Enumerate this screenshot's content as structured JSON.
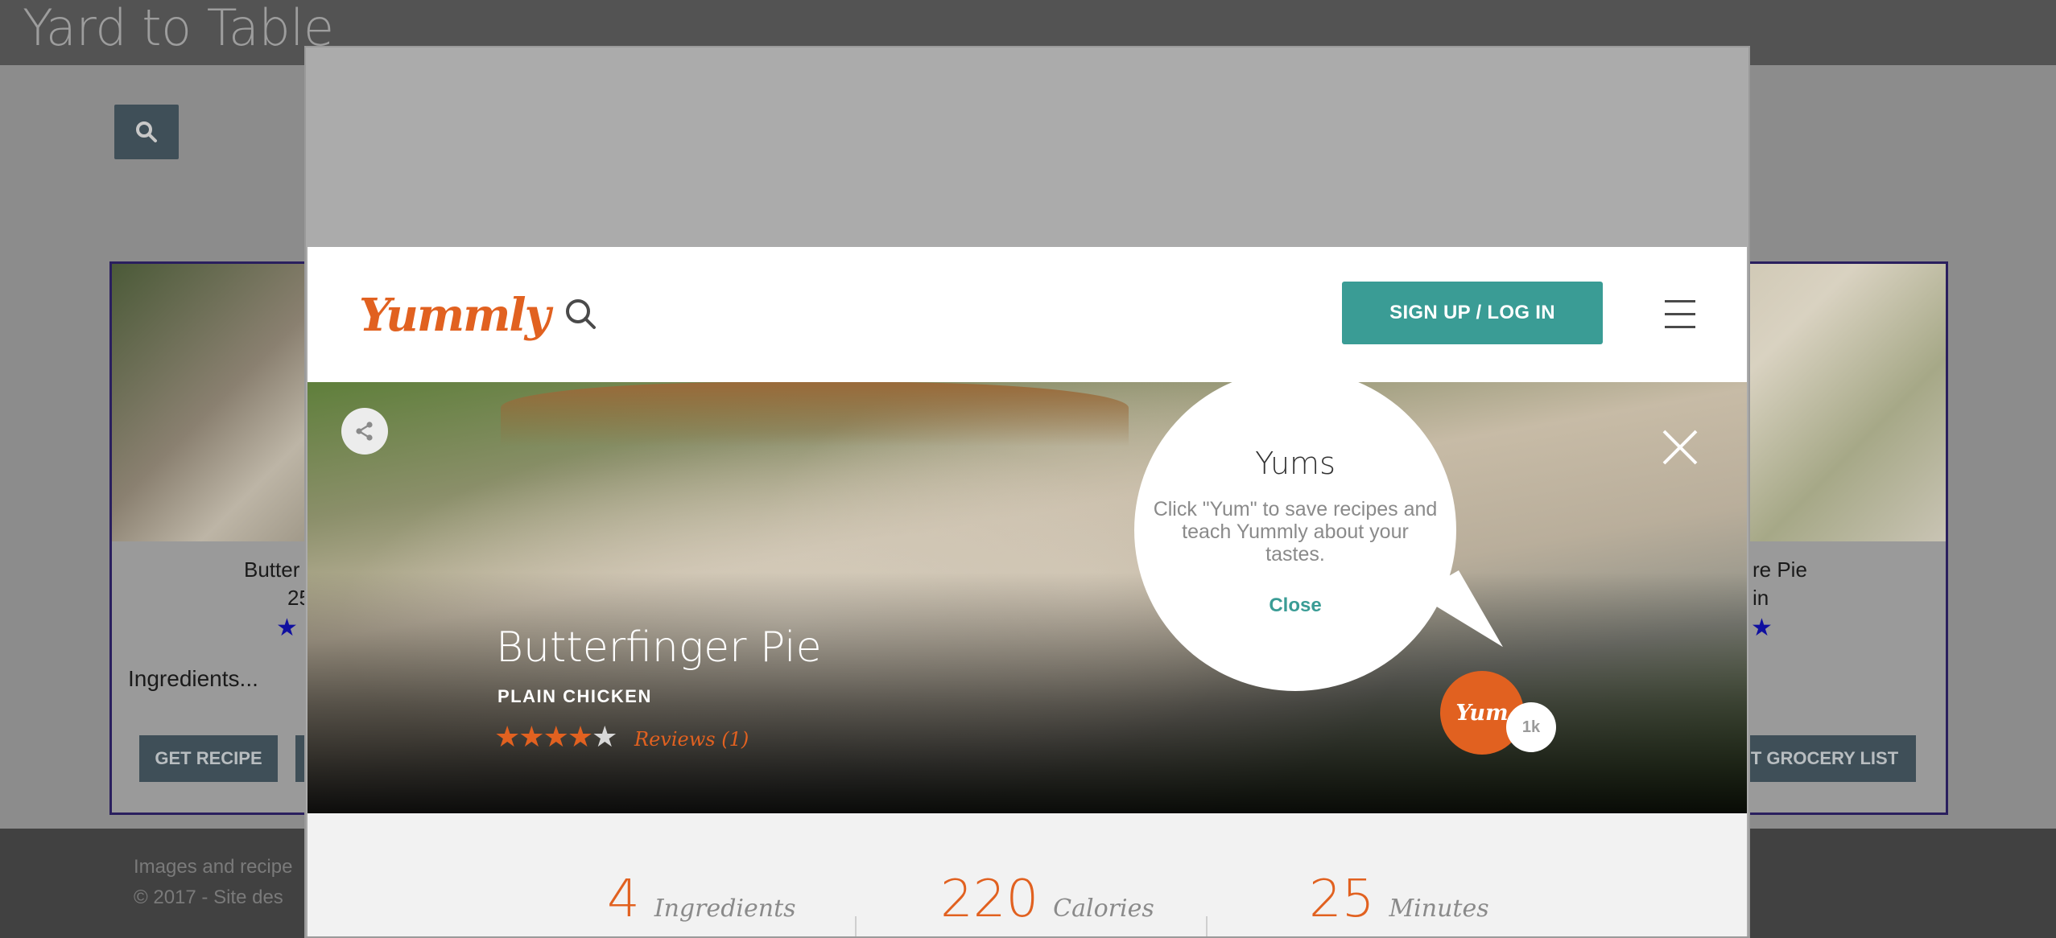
{
  "background": {
    "site_title": "Yard to Table",
    "left_card": {
      "name": "Butter",
      "time": "25",
      "stars": "★",
      "ingredients": "Ingredients...",
      "button": "GET RECIPE"
    },
    "right_card": {
      "name": "re Pie",
      "time": "in",
      "stars": "★",
      "button": "T GROCERY LIST"
    },
    "footer": {
      "line1": "Images and recipe",
      "line2": "© 2017 - Site des"
    }
  },
  "yummly": {
    "logo": "Yummly",
    "signup_label": "SIGN UP / LOG IN",
    "recipe": {
      "title": "Butterfinger Pie",
      "source": "PLAIN CHICKEN",
      "rating": 4,
      "max_rating": 5,
      "reviews_label": "Reviews (1)"
    },
    "yums_popup": {
      "title": "Yums",
      "text": "Click \"Yum\" to save recipes and teach Yummly about your tastes.",
      "close_label": "Close"
    },
    "yum_button": "Yum",
    "yum_count": "1k",
    "stats": [
      {
        "value": "4",
        "label": "Ingredients"
      },
      {
        "value": "220",
        "label": "Calories"
      },
      {
        "value": "25",
        "label": "Minutes"
      }
    ]
  },
  "colors": {
    "accent_orange": "#e16120",
    "teal": "#3a9c95",
    "header_gray": "#535353"
  }
}
